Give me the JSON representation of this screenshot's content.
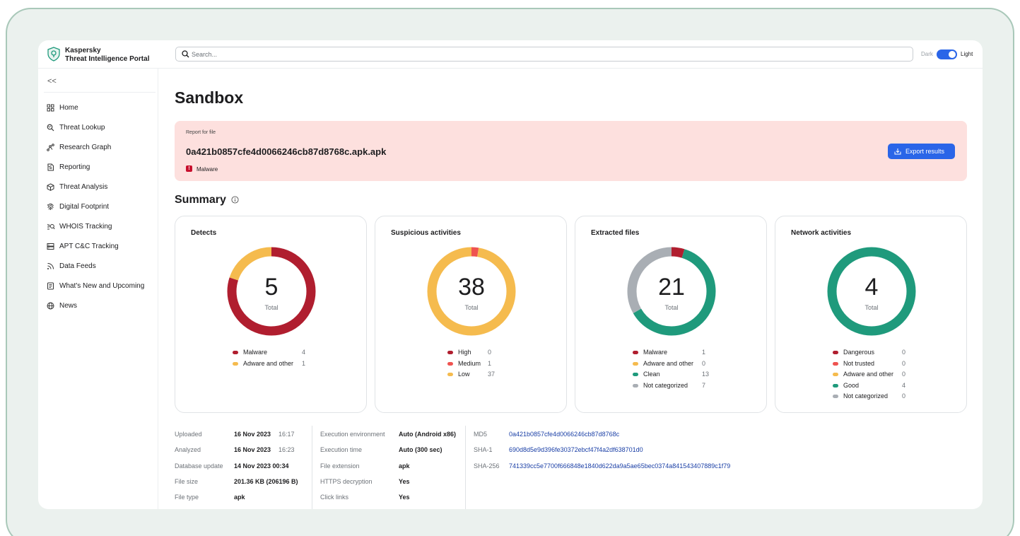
{
  "app": {
    "brand_line1": "Kaspersky",
    "brand_line2": "Threat Intelligence Portal",
    "search_placeholder": "Search...",
    "theme_dark": "Dark",
    "theme_light": "Light",
    "theme_selected": "Light"
  },
  "sidebar": {
    "collapse_label": "<<",
    "items": [
      {
        "label": "Home",
        "icon": "home-icon",
        "expandable": false
      },
      {
        "label": "Threat Lookup",
        "icon": "search-icon",
        "expandable": true
      },
      {
        "label": "Research Graph",
        "icon": "graph-icon",
        "expandable": false
      },
      {
        "label": "Reporting",
        "icon": "report-icon",
        "expandable": true
      },
      {
        "label": "Threat Analysis",
        "icon": "cube-icon",
        "expandable": false
      },
      {
        "label": "Digital Footprint",
        "icon": "fingerprint-icon",
        "expandable": true
      },
      {
        "label": "WHOIS Tracking",
        "icon": "whois-icon",
        "expandable": true
      },
      {
        "label": "APT C&C Tracking",
        "icon": "server-icon",
        "expandable": false
      },
      {
        "label": "Data Feeds",
        "icon": "feed-icon",
        "expandable": false
      },
      {
        "label": "What's New and Upcoming",
        "icon": "news-list-icon",
        "expandable": false
      },
      {
        "label": "News",
        "icon": "globe-icon",
        "expandable": false
      }
    ]
  },
  "main": {
    "title": "Sandbox",
    "report": {
      "label": "Report for file",
      "file_name": "0a421b0857cfe4d0066246cb87d8768c.apk.apk",
      "verdict_mark": "!",
      "verdict": "Malware",
      "export_label": "Export results"
    },
    "summary_title": "Summary",
    "total_label": "Total",
    "cards": [
      {
        "title": "Detects",
        "total": "5",
        "segments": [
          {
            "name": "Malware",
            "value": 4,
            "color": "#b01e2f"
          },
          {
            "name": "Adware and other",
            "value": 1,
            "color": "#f5bb4e"
          }
        ]
      },
      {
        "title": "Suspicious activities",
        "total": "38",
        "segments": [
          {
            "name": "High",
            "value": 0,
            "color": "#b01e2f"
          },
          {
            "name": "Medium",
            "value": 1,
            "color": "#ef5350"
          },
          {
            "name": "Low",
            "value": 37,
            "color": "#f5bb4e"
          }
        ]
      },
      {
        "title": "Extracted files",
        "total": "21",
        "segments": [
          {
            "name": "Malware",
            "value": 1,
            "color": "#b01e2f"
          },
          {
            "name": "Adware and other",
            "value": 0,
            "color": "#f5bb4e"
          },
          {
            "name": "Clean",
            "value": 13,
            "color": "#1f9a7c"
          },
          {
            "name": "Not categorized",
            "value": 7,
            "color": "#a9aeb4"
          }
        ]
      },
      {
        "title": "Network activities",
        "total": "4",
        "segments": [
          {
            "name": "Dangerous",
            "value": 0,
            "color": "#b01e2f"
          },
          {
            "name": "Not trusted",
            "value": 0,
            "color": "#ef5350"
          },
          {
            "name": "Adware and other",
            "value": 0,
            "color": "#f5bb4e"
          },
          {
            "name": "Good",
            "value": 4,
            "color": "#1f9a7c"
          },
          {
            "name": "Not categorized",
            "value": 0,
            "color": "#a9aeb4"
          }
        ]
      }
    ],
    "details_col1": [
      {
        "key": "Uploaded",
        "value": "16 Nov 2023",
        "extra": "16:17"
      },
      {
        "key": "Analyzed",
        "value": "16 Nov 2023",
        "extra": "16:23"
      },
      {
        "key": "Database update",
        "value": "14 Nov 2023 00:34",
        "extra": ""
      },
      {
        "key": "File size",
        "value": "201.36 KB (206196 B)",
        "extra": ""
      },
      {
        "key": "File type",
        "value": "apk",
        "extra": ""
      }
    ],
    "details_col2": [
      {
        "key": "Execution environment",
        "value": "Auto (Android x86)"
      },
      {
        "key": "Execution time",
        "value": "Auto (300 sec)"
      },
      {
        "key": "File extension",
        "value": "apk"
      },
      {
        "key": "HTTPS decryption",
        "value": "Yes"
      },
      {
        "key": "Click links",
        "value": "Yes"
      }
    ],
    "hashes": [
      {
        "key": "MD5",
        "value": "0a421b0857cfe4d0066246cb87d8768c"
      },
      {
        "key": "SHA-1",
        "value": "690d8d5e9d396fe30372ebcf47f4a2df638701d0"
      },
      {
        "key": "SHA-256",
        "value": "741339cc5e7700f666848e1840d622da9a5ae65bec0374a841543407889c1f79"
      }
    ]
  }
}
